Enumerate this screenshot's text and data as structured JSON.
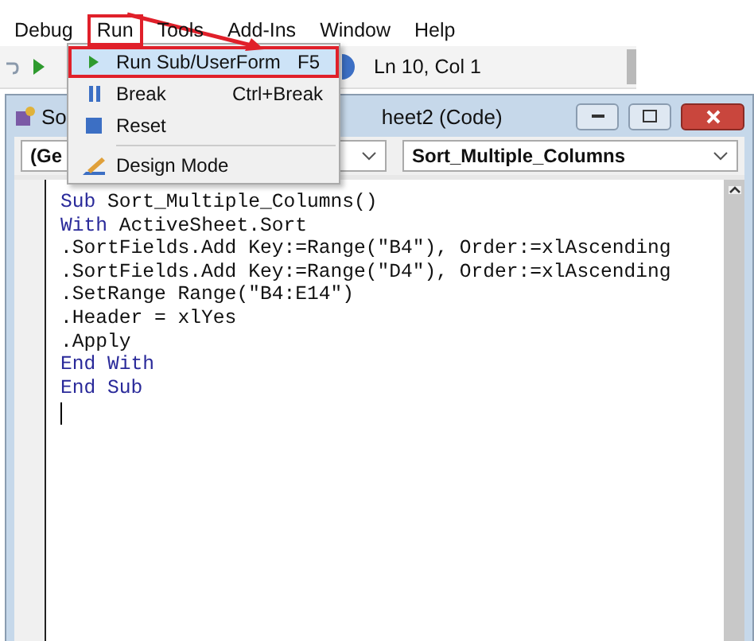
{
  "menu_bar": [
    {
      "label": "Debug",
      "selected": false
    },
    {
      "label": "Run",
      "selected": true
    },
    {
      "label": "Tools",
      "selected": false
    },
    {
      "label": "Add-Ins",
      "selected": false
    },
    {
      "label": "Window",
      "selected": false
    },
    {
      "label": "Help",
      "selected": false
    }
  ],
  "status": "Ln 10, Col 1",
  "code_window": {
    "title_start": "So",
    "title_end": "heet2 (Code)",
    "object_combo": "(Ge",
    "procedure_combo": "Sort_Multiple_Columns",
    "lines": [
      [
        {
          "text": "Sub",
          "kind": "keyword"
        },
        {
          "text": " Sort_Multiple_Columns()",
          "kind": "plain"
        }
      ],
      [
        {
          "text": "With",
          "kind": "keyword"
        },
        {
          "text": " ActiveSheet.Sort",
          "kind": "plain"
        }
      ],
      [
        {
          "text": ".SortFields.Add Key:=Range(\"B4\"), Order:=xlAscending",
          "kind": "plain"
        }
      ],
      [
        {
          "text": ".SortFields.Add Key:=Range(\"D4\"), Order:=xlAscending",
          "kind": "plain"
        }
      ],
      [
        {
          "text": ".SetRange Range(\"B4:E14\")",
          "kind": "plain"
        }
      ],
      [
        {
          "text": ".Header = xlYes",
          "kind": "plain"
        }
      ],
      [
        {
          "text": ".Apply",
          "kind": "plain"
        }
      ],
      [
        {
          "text": "End With",
          "kind": "keyword"
        }
      ],
      [
        {
          "text": "End Sub",
          "kind": "keyword"
        }
      ]
    ]
  },
  "run_menu": [
    {
      "kind": "play",
      "label": "Run Sub/UserForm",
      "shortcut": "F5",
      "selected": true
    },
    {
      "kind": "pause",
      "label": "Break",
      "shortcut": "Ctrl+Break",
      "selected": false
    },
    {
      "kind": "stop",
      "label": "Reset",
      "selected": false
    },
    {
      "kind": "design",
      "label": "Design Mode",
      "selected": false,
      "separator_before": true
    }
  ]
}
